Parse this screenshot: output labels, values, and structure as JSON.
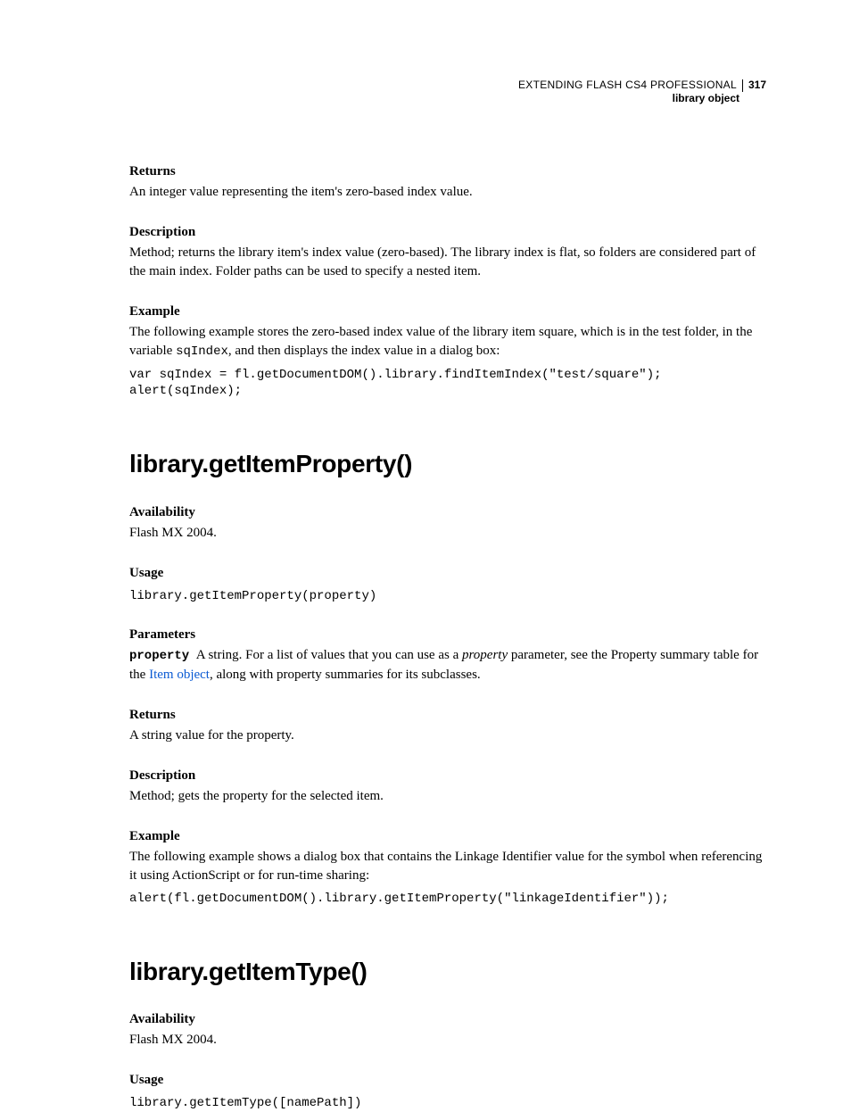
{
  "header": {
    "title": "EXTENDING FLASH CS4 PROFESSIONAL",
    "page": "317",
    "subtitle": "library object"
  },
  "s1": {
    "returns_h": "Returns",
    "returns_b": "An integer value representing the item's zero-based index value.",
    "desc_h": "Description",
    "desc_b": "Method; returns the library item's index value (zero-based). The library index is flat, so folders are considered part of the main index. Folder paths can be used to specify a nested item.",
    "ex_h": "Example",
    "ex_b_pre": "The following example stores the zero-based index value of the library item square, which is in the test folder, in the variable ",
    "ex_b_code": "sqIndex",
    "ex_b_post": ", and then displays the index value in a dialog box:",
    "code": "var sqIndex = fl.getDocumentDOM().library.findItemIndex(\"test/square\");\nalert(sqIndex);"
  },
  "s2": {
    "title": "library.getItemProperty()",
    "avail_h": "Availability",
    "avail_b": "Flash MX 2004.",
    "usage_h": "Usage",
    "usage_code": "library.getItemProperty(property)",
    "params_h": "Parameters",
    "params_code": "property",
    "params_pre": "A string. For a list of values that you can use as a ",
    "params_ital": "property",
    "params_mid": " parameter, see the Property summary table for the ",
    "params_link": "Item object",
    "params_post": ", along with property summaries for its subclasses.",
    "returns_h": "Returns",
    "returns_b": "A string value for the property.",
    "desc_h": "Description",
    "desc_b": "Method; gets the property for the selected item.",
    "ex_h": "Example",
    "ex_b": "The following example shows a dialog box that contains the Linkage Identifier value for the symbol when referencing it using ActionScript or for run-time sharing:",
    "ex_code": "alert(fl.getDocumentDOM().library.getItemProperty(\"linkageIdentifier\"));"
  },
  "s3": {
    "title": "library.getItemType()",
    "avail_h": "Availability",
    "avail_b": "Flash MX 2004.",
    "usage_h": "Usage",
    "usage_code": "library.getItemType([namePath])"
  }
}
